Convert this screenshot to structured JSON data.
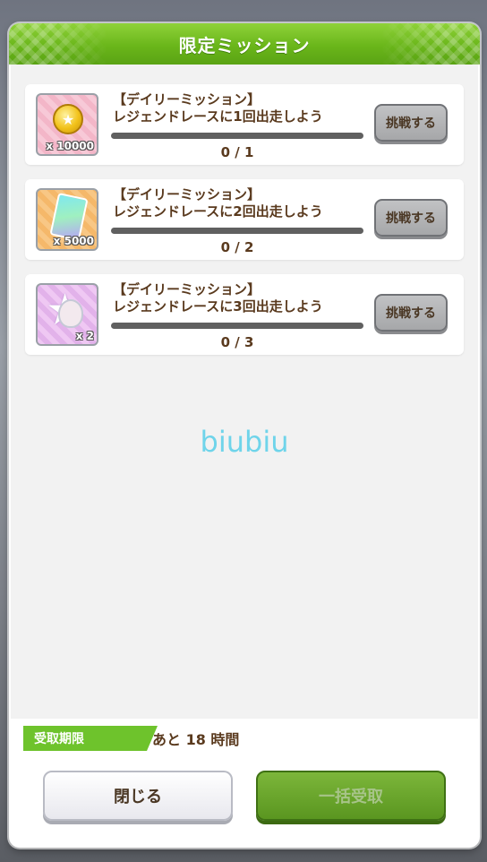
{
  "dialog": {
    "title": "限定ミッション"
  },
  "missions": [
    {
      "title_line1": "【デイリーミッション】",
      "title_line2": "レジェンドレースに1回出走しよう",
      "reward_icon": "coin-icon",
      "reward_qty": "x 10000",
      "progress_text": "0 / 1",
      "progress_fraction": 0,
      "button_label": "挑戦する"
    },
    {
      "title_line1": "【デイリーミッション】",
      "title_line2": "レジェンドレースに2回出走しよう",
      "reward_icon": "ticket-icon",
      "reward_qty": "x 5000",
      "progress_text": "0 / 2",
      "progress_fraction": 0,
      "button_label": "挑戦する"
    },
    {
      "title_line1": "【デイリーミッション】",
      "title_line2": "レジェンドレースに3回出走しよう",
      "reward_icon": "character-piece-icon",
      "reward_qty": "x 2",
      "progress_text": "0 / 3",
      "progress_fraction": 0,
      "button_label": "挑戦する"
    }
  ],
  "watermark": "biubiu",
  "deadline": {
    "label": "受取期限",
    "value": "あと 18 時間"
  },
  "footer": {
    "close_label": "閉じる",
    "receive_all_label": "一括受取"
  },
  "colors": {
    "header_green": "#6ab61a",
    "text_brown": "#5a3a1e",
    "watermark_cyan": "#6fd4ea"
  }
}
